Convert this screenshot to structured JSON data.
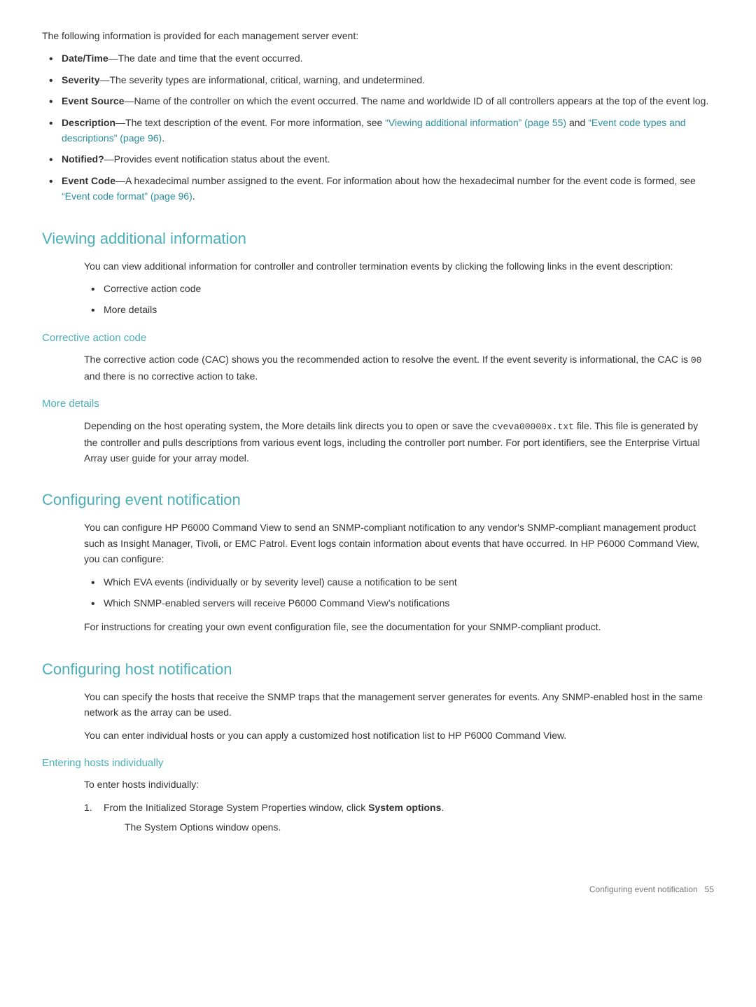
{
  "intro": {
    "paragraph": "The following information is provided for each management server event:",
    "bullets": [
      {
        "label": "Date/Time",
        "separator": "—",
        "text": "The date and time that the event occurred."
      },
      {
        "label": "Severity",
        "separator": "—",
        "text": "The severity types are informational, critical, warning, and undetermined."
      },
      {
        "label": "Event Source",
        "separator": "—",
        "text": "Name of the controller on which the event occurred. The name and worldwide ID of all controllers appears at the top of the event log."
      },
      {
        "label": "Description",
        "separator": "—",
        "text": "The text description of the event. For more information, see ",
        "link1_text": "“Viewing additional information” (page 55)",
        "link1_href": "#viewing-additional-information",
        "middle": " and ",
        "link2_text": "“Event code types and descriptions” (page 96)",
        "link2_href": "#event-code-types",
        "end": "."
      },
      {
        "label": "Notified?",
        "separator": "—",
        "text": "Provides event notification status about the event."
      },
      {
        "label": "Event Code",
        "separator": "—",
        "text": "A hexadecimal number assigned to the event. For information about how the hexadecimal number for the event code is formed, see ",
        "link_text": "“Event code format” (page 96)",
        "link_href": "#event-code-format",
        "end": "."
      }
    ]
  },
  "sections": {
    "viewing": {
      "heading": "Viewing additional information",
      "id": "viewing-additional-information",
      "intro": "You can view additional information for controller and controller termination events by clicking the following links in the event description:",
      "bullets": [
        "Corrective action code",
        "More details"
      ],
      "subsections": {
        "corrective": {
          "heading": "Corrective action code",
          "id": "corrective-action-code",
          "text": "The corrective action code (CAC) shows you the recommended action to resolve the event. If the event severity is informational, the CAC is ",
          "code": "00",
          "text2": " and there is no corrective action to take."
        },
        "moredetails": {
          "heading": "More details",
          "id": "more-details",
          "text": "Depending on the host operating system, the More details link directs you to open or save the ",
          "code": "cveva00000x.txt",
          "text2": " file. This file is generated by the controller and pulls descriptions from various event logs, including the controller port number. For port identifiers, see the Enterprise Virtual Array user guide for your array model."
        }
      }
    },
    "configuring_event": {
      "heading": "Configuring event notification",
      "id": "configuring-event-notification",
      "intro": "You can configure HP P6000 Command View to send an SNMP-compliant notification to any vendor's SNMP-compliant management product such as Insight Manager, Tivoli, or EMC Patrol. Event logs contain information about events that have occurred. In HP P6000 Command View, you can configure:",
      "bullets": [
        "Which EVA events (individually or by severity level) cause a notification to be sent",
        "Which SNMP-enabled servers will receive P6000 Command View’s notifications"
      ],
      "footer": "For instructions for creating your own event configuration file, see the documentation for your SNMP-compliant product."
    },
    "configuring_host": {
      "heading": "Configuring host notification",
      "id": "configuring-host-notification",
      "paragraphs": [
        "You can specify the hosts that receive the SNMP traps that the management server generates for events. Any SNMP-enabled host in the same network as the array can be used.",
        "You can enter individual hosts or you can apply a customized host notification list to HP P6000 Command View."
      ],
      "subsections": {
        "entering": {
          "heading": "Entering hosts individually",
          "id": "entering-hosts-individually",
          "intro": "To enter hosts individually:",
          "steps": [
            {
              "text": "From the Initialized Storage System Properties window, click ",
              "bold": "System options",
              "end": ".",
              "sub": "The System Options window opens."
            }
          ]
        }
      }
    }
  },
  "footer": {
    "text": "Configuring event notification",
    "page": "55"
  }
}
